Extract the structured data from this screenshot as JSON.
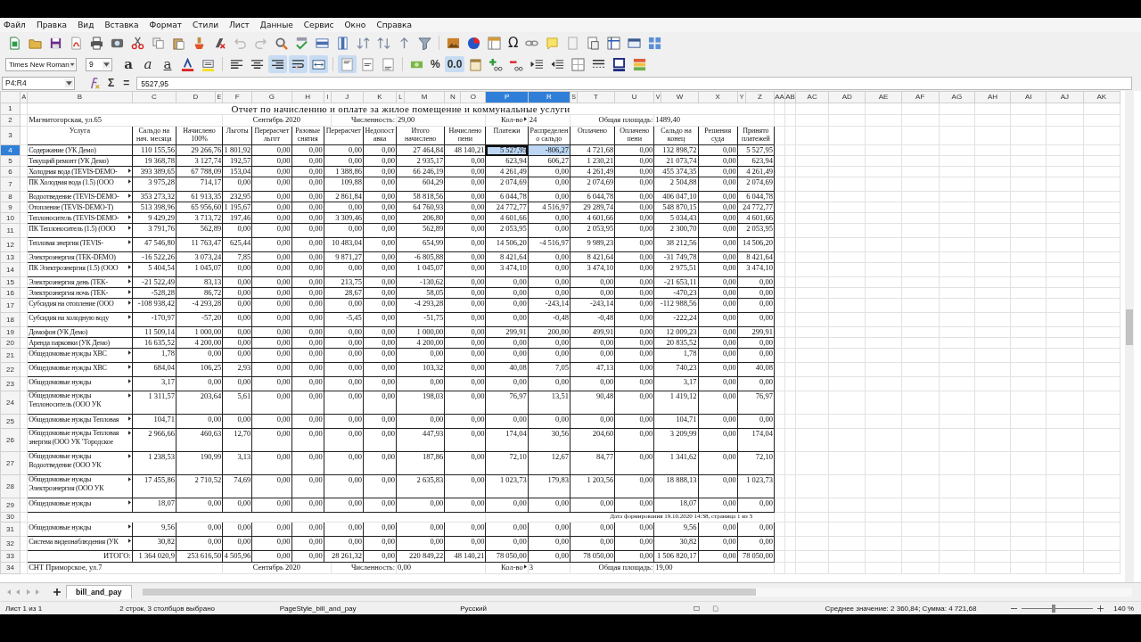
{
  "menu": [
    "Файл",
    "Правка",
    "Вид",
    "Вставка",
    "Формат",
    "Стили",
    "Лист",
    "Данные",
    "Сервис",
    "Окно",
    "Справка"
  ],
  "special_character_button": "Ω",
  "font_name": "Times New Roman",
  "font_size": "9",
  "text_style_buttons": [
    {
      "label": "a",
      "kind": "bold"
    },
    {
      "label": "a",
      "kind": "italic"
    },
    {
      "label": "a",
      "kind": "underline"
    }
  ],
  "align_buttons": [
    {
      "selected": false
    },
    {
      "selected": false
    },
    {
      "selected": true
    }
  ],
  "wrap_buttons": [
    {
      "selected": true
    },
    {
      "selected": true
    }
  ],
  "vertical_align_buttons": [
    {
      "selected": true
    },
    {
      "selected": false
    },
    {
      "selected": false
    }
  ],
  "number_buttons": [
    {
      "label": "%",
      "selected": false
    },
    {
      "label": "0.0",
      "selected": true
    }
  ],
  "name_box": "P4:R4",
  "formula_buttons": [
    "Σ",
    "="
  ],
  "formula": "5527,95",
  "columns": [
    {
      "letter": "A",
      "selected": false
    },
    {
      "letter": "B",
      "selected": false
    },
    {
      "letter": "C",
      "selected": false
    },
    {
      "letter": "D",
      "selected": false
    },
    {
      "letter": "E",
      "selected": false
    },
    {
      "letter": "F",
      "selected": false
    },
    {
      "letter": "G",
      "selected": false
    },
    {
      "letter": "H",
      "selected": false
    },
    {
      "letter": "I",
      "selected": false
    },
    {
      "letter": "J",
      "selected": false
    },
    {
      "letter": "K",
      "selected": false
    },
    {
      "letter": "L",
      "selected": false
    },
    {
      "letter": "M",
      "selected": false
    },
    {
      "letter": "N",
      "selected": false
    },
    {
      "letter": "O",
      "selected": false
    },
    {
      "letter": "P",
      "selected": true
    },
    {
      "letter": "R",
      "selected": true
    },
    {
      "letter": "S",
      "selected": false
    },
    {
      "letter": "T",
      "selected": false
    },
    {
      "letter": "U",
      "selected": false
    },
    {
      "letter": "V",
      "selected": false
    },
    {
      "letter": "W",
      "selected": false
    },
    {
      "letter": "X",
      "selected": false
    },
    {
      "letter": "Y",
      "selected": false
    },
    {
      "letter": "Z",
      "selected": false
    },
    {
      "letter": "AA",
      "selected": false
    },
    {
      "letter": "AB",
      "selected": false
    },
    {
      "letter": "AC",
      "selected": false
    },
    {
      "letter": "AD",
      "selected": false
    },
    {
      "letter": "AE",
      "selected": false
    },
    {
      "letter": "AF",
      "selected": false
    },
    {
      "letter": "AG",
      "selected": false
    },
    {
      "letter": "AH",
      "selected": false
    },
    {
      "letter": "AI",
      "selected": false
    },
    {
      "letter": "AJ",
      "selected": false
    },
    {
      "letter": "AK",
      "selected": false
    }
  ],
  "rows": [
    {
      "n": "1",
      "kind": "title",
      "selected": false,
      "text": "Отчет по начислению и оплате за жилое помещение и коммунальные услуги"
    },
    {
      "n": "2",
      "kind": "info",
      "selected": false,
      "address": "Магнитогорская, ул.65",
      "period": "Сентябрь 2020",
      "count_label": "Численность:",
      "count": "29,00",
      "contracts_label": "Кол-во",
      "contracts": "24",
      "area_label": "Общая площадь:",
      "area": "1489,40"
    },
    {
      "n": "3",
      "kind": "header",
      "selected": false,
      "labels": [
        "Услуга",
        "Сальдо на нач. месяца",
        "Начислено 100%",
        "Льготы",
        "Перерасчет льгот",
        "Разовые снятия",
        "Перерасчет",
        "Недопоставка",
        "Итого начислено",
        "Начислено пени",
        "Платежи",
        "Распределено сальдо",
        "Оплачено",
        "Оплачено пени",
        "Сальдо на конец",
        "Решения суда",
        "Принято платежей"
      ]
    },
    {
      "n": "4",
      "kind": "data",
      "selected": true,
      "service": [
        "Содержание (УК Демо)"
      ],
      "wrapped": false,
      "overflow": false,
      "values": [
        "110 155,56",
        "29 266,76",
        "1 801,92",
        "0,00",
        "0,00",
        "0,00",
        "0,00",
        "27 464,84",
        "48 140,21",
        "5 527,95",
        "-806,27",
        "4 721,68",
        "0,00",
        "132 898,72",
        "0,00",
        "5 527,95"
      ]
    },
    {
      "n": "5",
      "kind": "data",
      "selected": false,
      "service": [
        "Текущий ремонт (УК Демо)"
      ],
      "wrapped": false,
      "overflow": false,
      "values": [
        "19 368,78",
        "3 127,74",
        "192,57",
        "0,00",
        "0,00",
        "0,00",
        "0,00",
        "2 935,17",
        "0,00",
        "623,94",
        "606,27",
        "1 230,21",
        "0,00",
        "21 073,74",
        "0,00",
        "623,94"
      ]
    },
    {
      "n": "6",
      "kind": "data",
      "selected": false,
      "service": [
        "Холодная вода (TEVIS-DEMO-"
      ],
      "wrapped": false,
      "overflow": true,
      "values": [
        "393 389,65",
        "67 788,09",
        "153,04",
        "0,00",
        "0,00",
        "1 388,86",
        "0,00",
        "66 246,19",
        "0,00",
        "4 261,49",
        "0,00",
        "4 261,49",
        "0,00",
        "455 374,35",
        "0,00",
        "4 261,49"
      ]
    },
    {
      "n": "7",
      "kind": "data",
      "selected": false,
      "service": [
        "ПК Холодная вода (1.5) (ООО"
      ],
      "wrapped": true,
      "overflow": true,
      "values": [
        "3 975,28",
        "714,17",
        "0,00",
        "0,00",
        "0,00",
        "109,88",
        "0,00",
        "604,29",
        "0,00",
        "2 074,69",
        "0,00",
        "2 074,69",
        "0,00",
        "2 504,88",
        "0,00",
        "2 074,69"
      ]
    },
    {
      "n": "8",
      "kind": "data",
      "selected": false,
      "service": [
        "Водоотведение (TEVIS-DEMO-"
      ],
      "wrapped": false,
      "overflow": true,
      "values": [
        "353 273,32",
        "61 913,35",
        "232,95",
        "0,00",
        "0,00",
        "2 861,84",
        "0,00",
        "58 818,56",
        "0,00",
        "6 044,78",
        "0,00",
        "6 044,78",
        "0,00",
        "406 047,10",
        "0,00",
        "6 044,78"
      ]
    },
    {
      "n": "9",
      "kind": "data",
      "selected": false,
      "service": [
        "Отопление (TEVIS-DEMO-T)"
      ],
      "wrapped": false,
      "overflow": false,
      "values": [
        "513 398,96",
        "65 956,60",
        "1 195,67",
        "0,00",
        "0,00",
        "0,00",
        "0,00",
        "64 760,93",
        "0,00",
        "24 772,77",
        "4 516,97",
        "29 289,74",
        "0,00",
        "548 870,15",
        "0,00",
        "24 772,77"
      ]
    },
    {
      "n": "10",
      "kind": "data",
      "selected": false,
      "service": [
        "Теплоноситель (TEVIS-DEMO-"
      ],
      "wrapped": false,
      "overflow": true,
      "values": [
        "9 429,29",
        "3 713,72",
        "197,46",
        "0,00",
        "0,00",
        "3 309,46",
        "0,00",
        "206,80",
        "0,00",
        "4 601,66",
        "0,00",
        "4 601,66",
        "0,00",
        "5 034,43",
        "0,00",
        "4 601,66"
      ]
    },
    {
      "n": "11",
      "kind": "data",
      "selected": false,
      "service": [
        "ПК Теплоноситель (1.5) (ООО"
      ],
      "wrapped": true,
      "overflow": true,
      "values": [
        "3 791,76",
        "562,89",
        "0,00",
        "0,00",
        "0,00",
        "0,00",
        "0,00",
        "562,89",
        "0,00",
        "2 053,95",
        "0,00",
        "2 053,95",
        "0,00",
        "2 300,70",
        "0,00",
        "2 053,95"
      ]
    },
    {
      "n": "12",
      "kind": "data",
      "selected": false,
      "service": [
        "Тепловая энергия (TEVIS-"
      ],
      "wrapped": true,
      "overflow": true,
      "values": [
        "47 546,80",
        "11 763,47",
        "625,44",
        "0,00",
        "0,00",
        "10 483,04",
        "0,00",
        "654,99",
        "0,00",
        "14 506,20",
        "-4 516,97",
        "9 989,23",
        "0,00",
        "38 212,56",
        "0,00",
        "14 506,20"
      ]
    },
    {
      "n": "13",
      "kind": "data",
      "selected": false,
      "service": [
        "Электроэнергия (TEK-DEMO)"
      ],
      "wrapped": false,
      "overflow": false,
      "values": [
        "-16 522,26",
        "3 073,24",
        "7,85",
        "0,00",
        "0,00",
        "9 871,27",
        "0,00",
        "-6 805,88",
        "0,00",
        "8 421,64",
        "0,00",
        "8 421,64",
        "0,00",
        "-31 749,78",
        "0,00",
        "8 421,64"
      ]
    },
    {
      "n": "14",
      "kind": "data",
      "selected": false,
      "service": [
        "ПК Электроэнергия (1.5) (ООО"
      ],
      "wrapped": true,
      "overflow": true,
      "values": [
        "5 404,54",
        "1 045,07",
        "0,00",
        "0,00",
        "0,00",
        "0,00",
        "0,00",
        "1 045,07",
        "0,00",
        "3 474,10",
        "0,00",
        "3 474,10",
        "0,00",
        "2 975,51",
        "0,00",
        "3 474,10"
      ]
    },
    {
      "n": "15",
      "kind": "data",
      "selected": false,
      "service": [
        "Электроэнергия день (TEK-"
      ],
      "wrapped": false,
      "overflow": true,
      "values": [
        "-21 522,49",
        "83,13",
        "0,00",
        "0,00",
        "0,00",
        "213,75",
        "0,00",
        "-130,62",
        "0,00",
        "0,00",
        "0,00",
        "0,00",
        "0,00",
        "-21 653,11",
        "0,00",
        "0,00"
      ]
    },
    {
      "n": "16",
      "kind": "data",
      "selected": false,
      "service": [
        "Электроэнергия ночь (TEK-"
      ],
      "wrapped": false,
      "overflow": true,
      "values": [
        "-528,28",
        "86,72",
        "0,00",
        "0,00",
        "0,00",
        "28,67",
        "0,00",
        "58,05",
        "0,00",
        "0,00",
        "0,00",
        "0,00",
        "0,00",
        "-470,23",
        "0,00",
        "0,00"
      ]
    },
    {
      "n": "17",
      "kind": "data",
      "selected": false,
      "service": [
        "Субсидия на отопление (ООО"
      ],
      "wrapped": true,
      "overflow": true,
      "values": [
        "-108 938,42",
        "-4 293,28",
        "0,00",
        "0,00",
        "0,00",
        "0,00",
        "0,00",
        "-4 293,28",
        "0,00",
        "0,00",
        "-243,14",
        "-243,14",
        "0,00",
        "-112 988,56",
        "0,00",
        "0,00"
      ]
    },
    {
      "n": "18",
      "kind": "data",
      "selected": false,
      "service": [
        "Субсидия на холодную воду"
      ],
      "wrapped": true,
      "overflow": true,
      "values": [
        "-170,97",
        "-57,20",
        "0,00",
        "0,00",
        "0,00",
        "-5,45",
        "0,00",
        "-51,75",
        "0,00",
        "0,00",
        "-0,48",
        "-0,48",
        "0,00",
        "-222,24",
        "0,00",
        "0,00"
      ]
    },
    {
      "n": "19",
      "kind": "data",
      "selected": false,
      "service": [
        "Домофон (УК Демо)"
      ],
      "wrapped": false,
      "overflow": false,
      "values": [
        "11 509,14",
        "1 000,00",
        "0,00",
        "0,00",
        "0,00",
        "0,00",
        "0,00",
        "1 000,00",
        "0,00",
        "299,91",
        "200,00",
        "499,91",
        "0,00",
        "12 009,23",
        "0,00",
        "299,91"
      ]
    },
    {
      "n": "20",
      "kind": "data",
      "selected": false,
      "service": [
        "Аренда парковки (УК Демо)"
      ],
      "wrapped": false,
      "overflow": false,
      "values": [
        "16 635,52",
        "4 200,00",
        "0,00",
        "0,00",
        "0,00",
        "0,00",
        "0,00",
        "4 200,00",
        "0,00",
        "0,00",
        "0,00",
        "0,00",
        "0,00",
        "20 835,52",
        "0,00",
        "0,00"
      ]
    },
    {
      "n": "21",
      "kind": "data",
      "selected": false,
      "service": [
        "Общедомовые нужды ХВС"
      ],
      "wrapped": true,
      "overflow": true,
      "values": [
        "1,78",
        "0,00",
        "0,00",
        "0,00",
        "0,00",
        "0,00",
        "0,00",
        "0,00",
        "0,00",
        "0,00",
        "0,00",
        "0,00",
        "0,00",
        "1,78",
        "0,00",
        "0,00"
      ]
    },
    {
      "n": "22",
      "kind": "data",
      "selected": false,
      "service": [
        "Общедомовые нужды ХВС"
      ],
      "wrapped": true,
      "overflow": true,
      "values": [
        "684,04",
        "106,25",
        "2,93",
        "0,00",
        "0,00",
        "0,00",
        "0,00",
        "103,32",
        "0,00",
        "40,08",
        "7,05",
        "47,13",
        "0,00",
        "740,23",
        "0,00",
        "40,08"
      ]
    },
    {
      "n": "23",
      "kind": "data",
      "selected": false,
      "service": [
        "Общедомовые нужды"
      ],
      "wrapped": true,
      "overflow": true,
      "values": [
        "3,17",
        "0,00",
        "0,00",
        "0,00",
        "0,00",
        "0,00",
        "0,00",
        "0,00",
        "0,00",
        "0,00",
        "0,00",
        "0,00",
        "0,00",
        "3,17",
        "0,00",
        "0,00"
      ]
    },
    {
      "n": "24",
      "kind": "data",
      "selected": false,
      "service": [
        "Общедомовые нужды",
        "Теплоноситель (ООО УК"
      ],
      "wrapped": true,
      "overflow": true,
      "values": [
        "1 311,57",
        "203,64",
        "5,61",
        "0,00",
        "0,00",
        "0,00",
        "0,00",
        "198,03",
        "0,00",
        "76,97",
        "13,51",
        "90,48",
        "0,00",
        "1 419,12",
        "0,00",
        "76,97"
      ]
    },
    {
      "n": "25",
      "kind": "data",
      "selected": false,
      "service": [
        "Общедомовые нужды Тепловая"
      ],
      "wrapped": true,
      "overflow": true,
      "values": [
        "104,71",
        "0,00",
        "0,00",
        "0,00",
        "0,00",
        "0,00",
        "0,00",
        "0,00",
        "0,00",
        "0,00",
        "0,00",
        "0,00",
        "0,00",
        "104,71",
        "0,00",
        "0,00"
      ]
    },
    {
      "n": "26",
      "kind": "data",
      "selected": false,
      "service": [
        "Общедомовые нужды Тепловая",
        "энергия (ООО УК \"Городское"
      ],
      "wrapped": true,
      "overflow": true,
      "values": [
        "2 966,66",
        "460,63",
        "12,70",
        "0,00",
        "0,00",
        "0,00",
        "0,00",
        "447,93",
        "0,00",
        "174,04",
        "30,56",
        "204,60",
        "0,00",
        "3 209,99",
        "0,00",
        "174,04"
      ]
    },
    {
      "n": "27",
      "kind": "data",
      "selected": false,
      "service": [
        "Общедомовые нужды",
        "Водоотведение (ООО УК"
      ],
      "wrapped": true,
      "overflow": true,
      "values": [
        "1 238,53",
        "190,99",
        "3,13",
        "0,00",
        "0,00",
        "0,00",
        "0,00",
        "187,86",
        "0,00",
        "72,10",
        "12,67",
        "84,77",
        "0,00",
        "1 341,62",
        "0,00",
        "72,10"
      ]
    },
    {
      "n": "28",
      "kind": "data",
      "selected": false,
      "service": [
        "Общедомовые нужды",
        "Электроэнергия (ООО УК"
      ],
      "wrapped": true,
      "overflow": true,
      "values": [
        "17 455,86",
        "2 710,52",
        "74,69",
        "0,00",
        "0,00",
        "0,00",
        "0,00",
        "2 635,83",
        "0,00",
        "1 023,73",
        "179,83",
        "1 203,56",
        "0,00",
        "18 888,13",
        "0,00",
        "1 023,73"
      ]
    },
    {
      "n": "29",
      "kind": "data",
      "selected": false,
      "service": [
        "Общедомовые нужды"
      ],
      "wrapped": true,
      "overflow": true,
      "values": [
        "18,07",
        "0,00",
        "0,00",
        "0,00",
        "0,00",
        "0,00",
        "0,00",
        "0,00",
        "0,00",
        "0,00",
        "0,00",
        "0,00",
        "0,00",
        "18,07",
        "0,00",
        "0,00"
      ]
    },
    {
      "n": "30",
      "kind": "note",
      "selected": false,
      "text": "Дата формирования 19.10.2020 14:38, страница 1 из 3"
    },
    {
      "n": "31",
      "kind": "data",
      "selected": false,
      "service": [
        "Общедомовые нужды"
      ],
      "wrapped": true,
      "overflow": true,
      "values": [
        "9,56",
        "0,00",
        "0,00",
        "0,00",
        "0,00",
        "0,00",
        "0,00",
        "0,00",
        "0,00",
        "0,00",
        "0,00",
        "0,00",
        "0,00",
        "9,56",
        "0,00",
        "0,00"
      ]
    },
    {
      "n": "32",
      "kind": "data",
      "selected": false,
      "service": [
        "Система видеонаблюдения (УК"
      ],
      "wrapped": true,
      "overflow": true,
      "values": [
        "30,82",
        "0,00",
        "0,00",
        "0,00",
        "0,00",
        "0,00",
        "0,00",
        "0,00",
        "0,00",
        "0,00",
        "0,00",
        "0,00",
        "0,00",
        "30,82",
        "0,00",
        "0,00"
      ]
    },
    {
      "n": "33",
      "kind": "total",
      "selected": false,
      "label": "ИТОГО:",
      "values": [
        "1 364 020,9",
        "253 616,50",
        "4 505,96",
        "0,00",
        "0,00",
        "28 261,32",
        "0,00",
        "220 849,22",
        "48 140,21",
        "78 050,00",
        "0,00",
        "78 050,00",
        "0,00",
        "1 506 820,17",
        "0,00",
        "78 050,00"
      ]
    },
    {
      "n": "34",
      "kind": "info",
      "selected": false,
      "address": "СНТ Приморское, ул.7",
      "period": "Сентябрь 2020",
      "count_label": "Численность:",
      "count": "0,00",
      "contracts_label": "Кол-во",
      "contracts": "3",
      "area_label": "Общая площадь:",
      "area": "19,00"
    }
  ],
  "sheet_tabs": [
    {
      "label": "bill_and_pay",
      "selected": true
    }
  ],
  "status_bar": {
    "sheet": "Лист 1 из 1",
    "selection": "2 строк, 3 столбцов выбрано",
    "page_style": "PageStyle_bill_and_pay",
    "language": "Русский",
    "summary": "Среднее значение: 2 360,84; Сумма: 4 721,68",
    "zoom": {
      "level": 0.45,
      "reading": "140 %"
    }
  }
}
